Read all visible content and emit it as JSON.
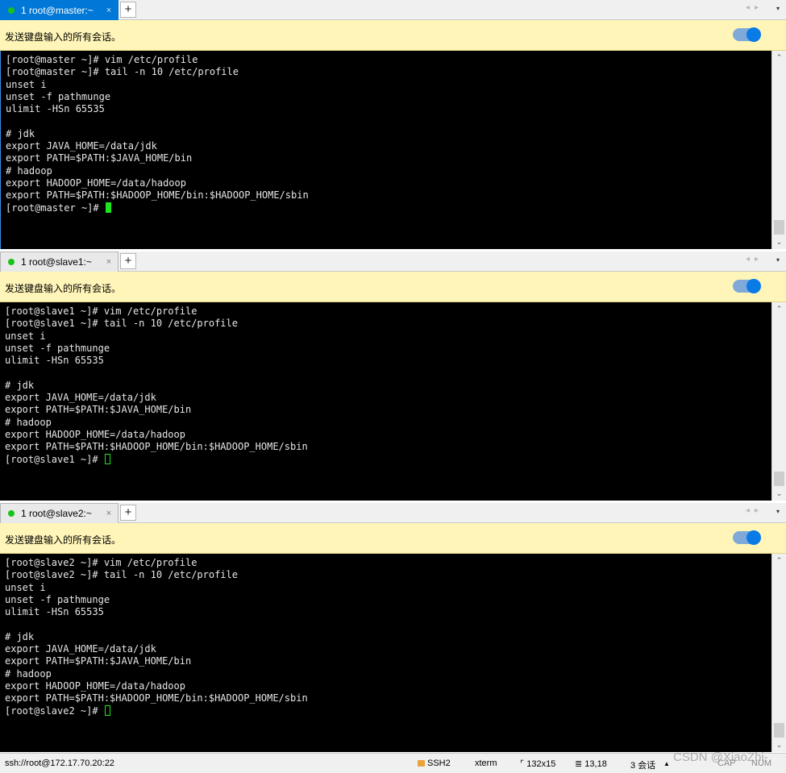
{
  "notice_text": "发送键盘输入的所有会话。",
  "tab_add": "+",
  "tab_close": "×",
  "tab_nav": "◂▸",
  "tab_menu": "▾",
  "scroll_up": "⌃",
  "scroll_down": "⌄",
  "panes": [
    {
      "tab_label": "1 root@master:~",
      "lines": [
        "[root@master ~]# vim /etc/profile",
        "[root@master ~]# tail -n 10 /etc/profile",
        "unset i",
        "unset -f pathmunge",
        "ulimit -HSn 65535",
        "",
        "# jdk",
        "export JAVA_HOME=/data/jdk",
        "export PATH=$PATH:$JAVA_HOME/bin",
        "# hadoop",
        "export HADOOP_HOME=/data/hadoop",
        "export PATH=$PATH:$HADOOP_HOME/bin:$HADOOP_HOME/sbin"
      ],
      "prompt": "[root@master ~]# "
    },
    {
      "tab_label": "1 root@slave1:~",
      "lines": [
        "[root@slave1 ~]# vim /etc/profile",
        "[root@slave1 ~]# tail -n 10 /etc/profile",
        "unset i",
        "unset -f pathmunge",
        "ulimit -HSn 65535",
        "",
        "# jdk",
        "export JAVA_HOME=/data/jdk",
        "export PATH=$PATH:$JAVA_HOME/bin",
        "# hadoop",
        "export HADOOP_HOME=/data/hadoop",
        "export PATH=$PATH:$HADOOP_HOME/bin:$HADOOP_HOME/sbin"
      ],
      "prompt": "[root@slave1 ~]# "
    },
    {
      "tab_label": "1 root@slave2:~",
      "lines": [
        "[root@slave2 ~]# vim /etc/profile",
        "[root@slave2 ~]# tail -n 10 /etc/profile",
        "unset i",
        "unset -f pathmunge",
        "ulimit -HSn 65535",
        "",
        "# jdk",
        "export JAVA_HOME=/data/jdk",
        "export PATH=$PATH:$JAVA_HOME/bin",
        "# hadoop",
        "export HADOOP_HOME=/data/hadoop",
        "export PATH=$PATH:$HADOOP_HOME/bin:$HADOOP_HOME/sbin"
      ],
      "prompt": "[root@slave2 ~]# "
    }
  ],
  "status": {
    "address": "ssh://root@172.17.70.20:22",
    "protocol": "SSH2",
    "terminal_type": "xterm",
    "size": "132x15",
    "cursor_pos": "13,18",
    "sessions": "3 会话",
    "arrow": "▲",
    "cap": "CAP",
    "num": "NUM"
  },
  "watermark": "CSDN @XiaoZhi-",
  "colors": {
    "active_tab": "#0078d7",
    "notice_bg": "#fff5b8",
    "toggle": "#0a7ae6",
    "cursor": "#1ee61e",
    "status_dot": "#17c21a"
  }
}
